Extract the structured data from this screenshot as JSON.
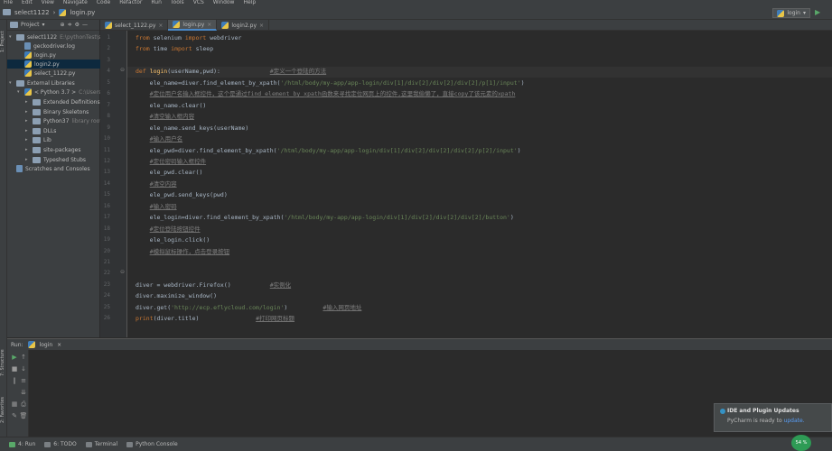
{
  "menubar": {
    "items": [
      "File",
      "Edit",
      "View",
      "Navigate",
      "Code",
      "Refactor",
      "Run",
      "Tools",
      "VCS",
      "Window",
      "Help"
    ]
  },
  "navbar": {
    "project": "select1122",
    "file": "login.py",
    "run_config": "login"
  },
  "project_panel": {
    "title": "Project",
    "tree": [
      {
        "label": "select1122",
        "path": "E:\\pythonTest\\se"
      },
      {
        "label": "geckodriver.log"
      },
      {
        "label": "login.py"
      },
      {
        "label": "login2.py"
      },
      {
        "label": "select_1122.py"
      },
      {
        "label": "External Libraries"
      },
      {
        "label": "< Python 3.7 >",
        "path": "C:\\Users\\s"
      },
      {
        "label": "Extended Definitions"
      },
      {
        "label": "Binary Skeletons"
      },
      {
        "label": "Python37",
        "path": "library root"
      },
      {
        "label": "DLLs"
      },
      {
        "label": "Lib"
      },
      {
        "label": "site-packages"
      },
      {
        "label": "Typeshed Stubs"
      },
      {
        "label": "Scratches and Consoles"
      }
    ]
  },
  "side_tabs": {
    "project": "1: Project",
    "structure": "7: Structure",
    "favorites": "2: Favorites"
  },
  "editor_tabs": [
    "select_1122.py",
    "login.py",
    "login2.py"
  ],
  "code_lines": [
    {
      "n": "1",
      "parts": [
        [
          "kw",
          "from "
        ],
        [
          "",
          "selenium "
        ],
        [
          "kw",
          "import "
        ],
        [
          "",
          "webdriver"
        ]
      ]
    },
    {
      "n": "2",
      "parts": [
        [
          "kw",
          "from "
        ],
        [
          "",
          "time "
        ],
        [
          "kw",
          "import "
        ],
        [
          "",
          "sleep"
        ]
      ]
    },
    {
      "n": "3",
      "parts": []
    },
    {
      "n": "4",
      "parts": [
        [
          "kw",
          "def "
        ],
        [
          "fn",
          "login"
        ],
        [
          "",
          "(userName,pwd):              "
        ],
        [
          "cmt",
          "#定义一个登陆的方法"
        ]
      ]
    },
    {
      "n": "5",
      "parts": [
        [
          "",
          "    ele_name=diver.find_element_by_xpath("
        ],
        [
          "str",
          "'/html/body/my-app/app-login/div[1]/div[2]/div[2]/div[2]/p[1]/input'"
        ],
        [
          "",
          ")"
        ]
      ]
    },
    {
      "n": "6",
      "parts": [
        [
          "",
          "    "
        ],
        [
          "cmt",
          "#定位用户名输入框控件，这个是通过find_element_by_xpath函数来寻找定位网页上的控件,这里我偷懒了，直接copy了该元素的xpath"
        ]
      ]
    },
    {
      "n": "7",
      "parts": [
        [
          "",
          "    ele_name.clear()"
        ]
      ]
    },
    {
      "n": "8",
      "parts": [
        [
          "",
          "    "
        ],
        [
          "cmt",
          "#清空输入框内容"
        ]
      ]
    },
    {
      "n": "9",
      "parts": [
        [
          "",
          "    ele_name.send_keys(userName)"
        ]
      ]
    },
    {
      "n": "10",
      "parts": [
        [
          "",
          "    "
        ],
        [
          "cmt",
          "#输入用户名"
        ]
      ]
    },
    {
      "n": "11",
      "parts": [
        [
          "",
          "    ele_pwd=diver.find_element_by_xpath("
        ],
        [
          "str",
          "'/html/body/my-app/app-login/div[1]/div[2]/div[2]/div[2]/p[2]/input'"
        ],
        [
          "",
          ")"
        ]
      ]
    },
    {
      "n": "12",
      "parts": [
        [
          "",
          "    "
        ],
        [
          "cmt",
          "#定位密码输入框控件"
        ]
      ]
    },
    {
      "n": "13",
      "parts": [
        [
          "",
          "    ele_pwd.clear()"
        ]
      ]
    },
    {
      "n": "14",
      "parts": [
        [
          "",
          "    "
        ],
        [
          "cmt",
          "#清空内容"
        ]
      ]
    },
    {
      "n": "15",
      "parts": [
        [
          "",
          "    ele_pwd.send_keys(pwd)"
        ]
      ]
    },
    {
      "n": "16",
      "parts": [
        [
          "",
          "    "
        ],
        [
          "cmt",
          "#输入密码"
        ]
      ]
    },
    {
      "n": "17",
      "parts": [
        [
          "",
          "    ele_login=diver.find_element_by_xpath("
        ],
        [
          "str",
          "'/html/body/my-app/app-login/div[1]/div[2]/div[2]/div[2]/button'"
        ],
        [
          "",
          ")"
        ]
      ]
    },
    {
      "n": "18",
      "parts": [
        [
          "",
          "    "
        ],
        [
          "cmt",
          "#定位登陆按钮控件"
        ]
      ]
    },
    {
      "n": "19",
      "parts": [
        [
          "",
          "    ele_login.click()"
        ]
      ]
    },
    {
      "n": "20",
      "parts": [
        [
          "",
          "    "
        ],
        [
          "cmt",
          "#模拟鼠标操作，点击登录按钮"
        ]
      ]
    },
    {
      "n": "21",
      "parts": []
    },
    {
      "n": "22",
      "parts": []
    },
    {
      "n": "23",
      "parts": [
        [
          "",
          "diver = webdriver.Firefox()           "
        ],
        [
          "cmt",
          "#实例化"
        ]
      ]
    },
    {
      "n": "24",
      "parts": [
        [
          "",
          "diver.maximize_window()"
        ]
      ]
    },
    {
      "n": "25",
      "parts": [
        [
          "",
          "diver.get("
        ],
        [
          "str",
          "'http://ecp.eflycloud.com/login'"
        ],
        [
          "",
          ")          "
        ],
        [
          "cmt",
          "#输入网页地址"
        ]
      ]
    },
    {
      "n": "26",
      "parts": [
        [
          "kw",
          "print"
        ],
        [
          "",
          "(diver.title)                "
        ],
        [
          "cmt",
          "#打印网页标题"
        ]
      ]
    }
  ],
  "run_panel": {
    "label": "Run:",
    "config": "login"
  },
  "bottom_tabs": [
    "4: Run",
    "6: TODO",
    "Terminal",
    "Python Console"
  ],
  "notification": {
    "title": "IDE and Plugin Updates",
    "body": "PyCharm is ready to ",
    "link": "update."
  },
  "memory": "54 %",
  "colors": {
    "accent": "#4a88c7",
    "keyword": "#cc7832",
    "string": "#6a8759",
    "comment": "#808080",
    "function": "#ffc66d"
  }
}
